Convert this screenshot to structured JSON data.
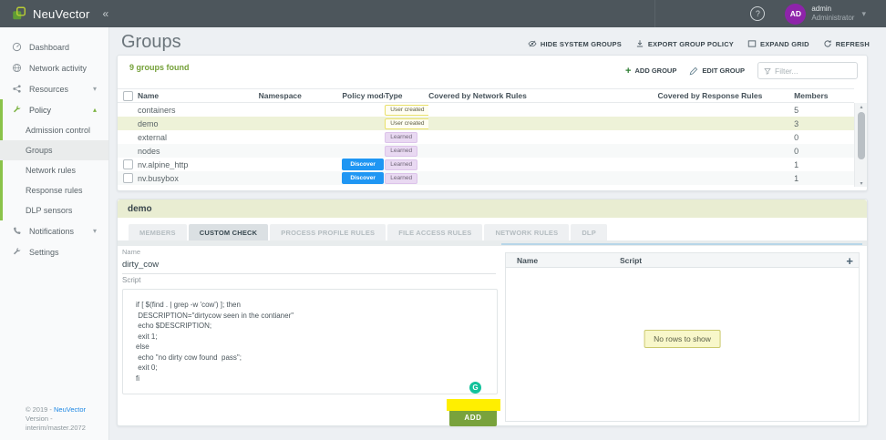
{
  "topbar": {
    "brand": "NeuVector",
    "collapse": "«",
    "help": "?",
    "user": {
      "initials": "AD",
      "name": "admin",
      "role": "Administrator"
    }
  },
  "sidebar": {
    "items": [
      {
        "label": "Dashboard",
        "icon": "gauge-icon"
      },
      {
        "label": "Network activity",
        "icon": "globe-icon"
      },
      {
        "label": "Resources",
        "icon": "share-icon",
        "chevron": "down"
      },
      {
        "label": "Policy",
        "icon": "wrench-icon",
        "chevron": "up",
        "active": true
      },
      {
        "label": "Admission control",
        "child": true
      },
      {
        "label": "Groups",
        "child": true,
        "selected": true
      },
      {
        "label": "Network rules",
        "child": true
      },
      {
        "label": "Response rules",
        "child": true
      },
      {
        "label": "DLP sensors",
        "child": true
      },
      {
        "label": "Notifications",
        "icon": "phone-icon",
        "chevron": "down"
      },
      {
        "label": "Settings",
        "icon": "spanner-icon"
      }
    ],
    "footer": {
      "copyright": "© 2019 -",
      "brand_link": "NeuVector",
      "version": "Version - interim/master.2072"
    }
  },
  "page": {
    "title": "Groups",
    "toolbar": [
      {
        "label": "HIDE SYSTEM GROUPS",
        "icon": "eye-off-icon"
      },
      {
        "label": "EXPORT GROUP POLICY",
        "icon": "download-icon"
      },
      {
        "label": "EXPAND GRID",
        "icon": "expand-icon"
      },
      {
        "label": "REFRESH",
        "icon": "refresh-icon"
      }
    ]
  },
  "groups_panel": {
    "count_text": "9 groups found",
    "add_group": "ADD GROUP",
    "edit_group": "EDIT GROUP",
    "filter_placeholder": "Filter...",
    "columns": [
      "Name",
      "Namespace",
      "Policy mode",
      "Type",
      "Covered by Network Rules",
      "Covered by Response Rules",
      "Members"
    ],
    "rows": [
      {
        "name": "containers",
        "namespace": "",
        "policy_mode": "",
        "type": "User created",
        "covered_network": "",
        "covered_response": "",
        "members": "5",
        "checkbox": false,
        "selected": false
      },
      {
        "name": "demo",
        "namespace": "",
        "policy_mode": "",
        "type": "User created",
        "covered_network": "",
        "covered_response": "",
        "members": "3",
        "checkbox": false,
        "selected": true
      },
      {
        "name": "external",
        "namespace": "",
        "policy_mode": "",
        "type": "Learned",
        "covered_network": "",
        "covered_response": "",
        "members": "0",
        "checkbox": false,
        "selected": false
      },
      {
        "name": "nodes",
        "namespace": "",
        "policy_mode": "",
        "type": "Learned",
        "covered_network": "",
        "covered_response": "",
        "members": "0",
        "checkbox": false,
        "selected": false
      },
      {
        "name": "nv.alpine_http",
        "namespace": "",
        "policy_mode": "Discover",
        "type": "Learned",
        "covered_network": "",
        "covered_response": "",
        "members": "1",
        "checkbox": true,
        "selected": false
      },
      {
        "name": "nv.busybox",
        "namespace": "",
        "policy_mode": "Discover",
        "type": "Learned",
        "covered_network": "",
        "covered_response": "",
        "members": "1",
        "checkbox": true,
        "selected": false
      }
    ]
  },
  "detail_panel": {
    "group_name": "demo",
    "tabs": [
      "MEMBERS",
      "CUSTOM CHECK",
      "PROCESS PROFILE RULES",
      "FILE ACCESS RULES",
      "NETWORK RULES",
      "DLP"
    ],
    "active_tab": "CUSTOM CHECK",
    "name_label": "Name",
    "name_value": "dirty_cow",
    "script_label": "Script",
    "script_lines": [
      "if [ $(find . | grep -w 'cow') ]; then",
      " DESCRIPTION=\"dirtycow seen in the contianer\"",
      " echo $DESCRIPTION;",
      " exit 1;",
      "else",
      " echo \"no dirty cow found  pass\";",
      " exit 0;",
      "fi"
    ],
    "add_button": "ADD",
    "grammarly_glyph": "G",
    "scripts_table": {
      "columns": [
        "Name",
        "Script"
      ],
      "empty_text": "No rows to show"
    }
  },
  "colors": {
    "brand_green": "#8bc34a",
    "discover_blue": "#1f96f3",
    "learned_badge_bg": "#e9d9f2",
    "user_created_border": "#e9e06b",
    "selected_row_bg": "#eef2d8",
    "detail_band_bg": "#e9edd2",
    "highlight_yellow": "#ffef00",
    "add_button_green": "#79a23c",
    "avatar_purple": "#8e24aa",
    "topbar_bg": "#4d565c"
  }
}
